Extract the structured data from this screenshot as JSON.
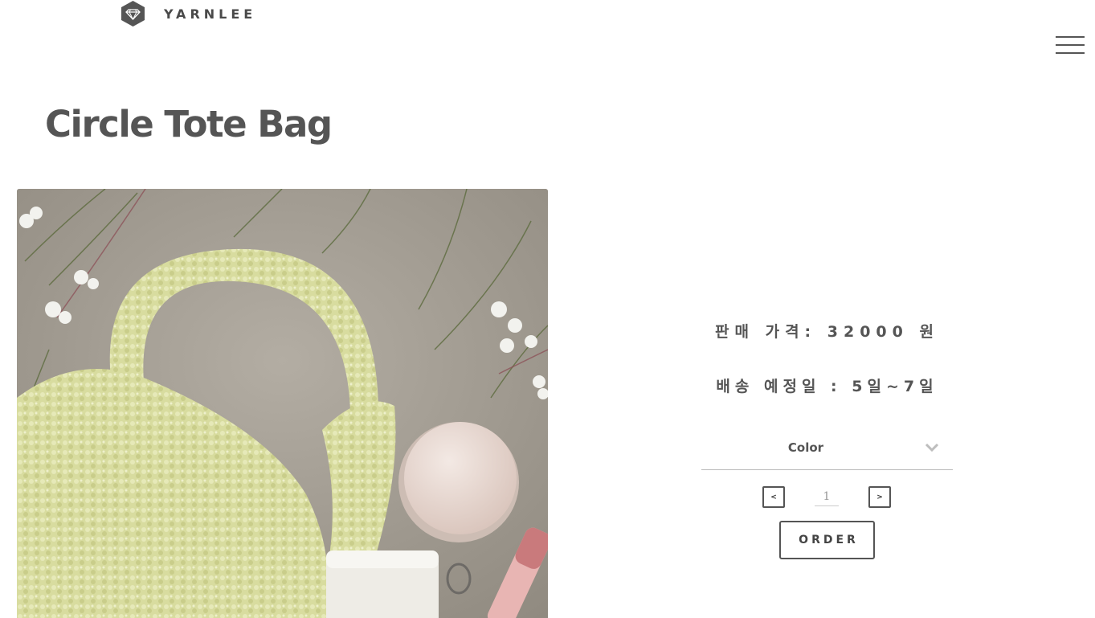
{
  "brand": {
    "name": "YARNLEE",
    "logo_icon": "diamond-icon"
  },
  "header": {
    "menu_icon": "hamburger-menu-icon"
  },
  "product": {
    "title": "Circle Tote Bag",
    "image_alt": "Circle Tote Bag",
    "price_text": "판매 가격: 32000 원",
    "shipping_text": "배송 예정일 : 5일~7일"
  },
  "options": {
    "color_label": "Color",
    "color_icon": "chevron-down-icon"
  },
  "quantity": {
    "decrement_label": "<",
    "increment_label": ">",
    "value": "1"
  },
  "actions": {
    "order_label": "ORDER"
  },
  "colors": {
    "text": "#555555",
    "border": "#555555",
    "logo": "#4a4a4a"
  }
}
